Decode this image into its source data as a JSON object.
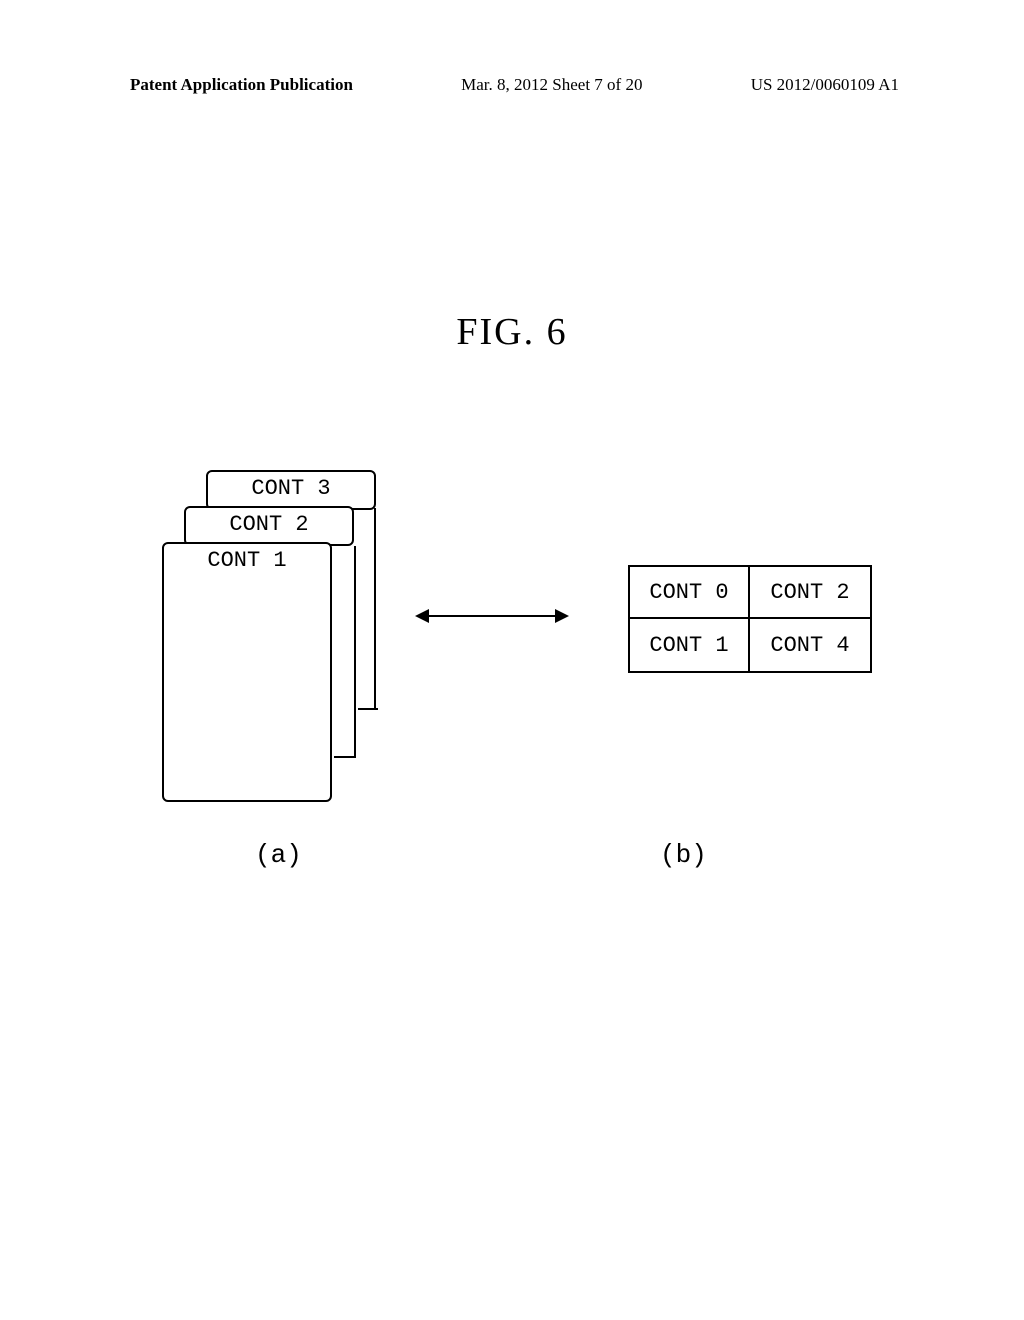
{
  "header": {
    "left": "Patent Application Publication",
    "center": "Mar. 8, 2012  Sheet 7 of 20",
    "right": "US 2012/0060109 A1"
  },
  "figure_title": "FIG. 6",
  "stack": {
    "card1": "CONT 1",
    "card2": "CONT 2",
    "card3": "CONT 3"
  },
  "grid": {
    "r0c0": "CONT 0",
    "r0c1": "CONT 2",
    "r1c0": "CONT 1",
    "r1c1": "CONT 4"
  },
  "sublabels": {
    "a": "(a)",
    "b": "(b)"
  }
}
